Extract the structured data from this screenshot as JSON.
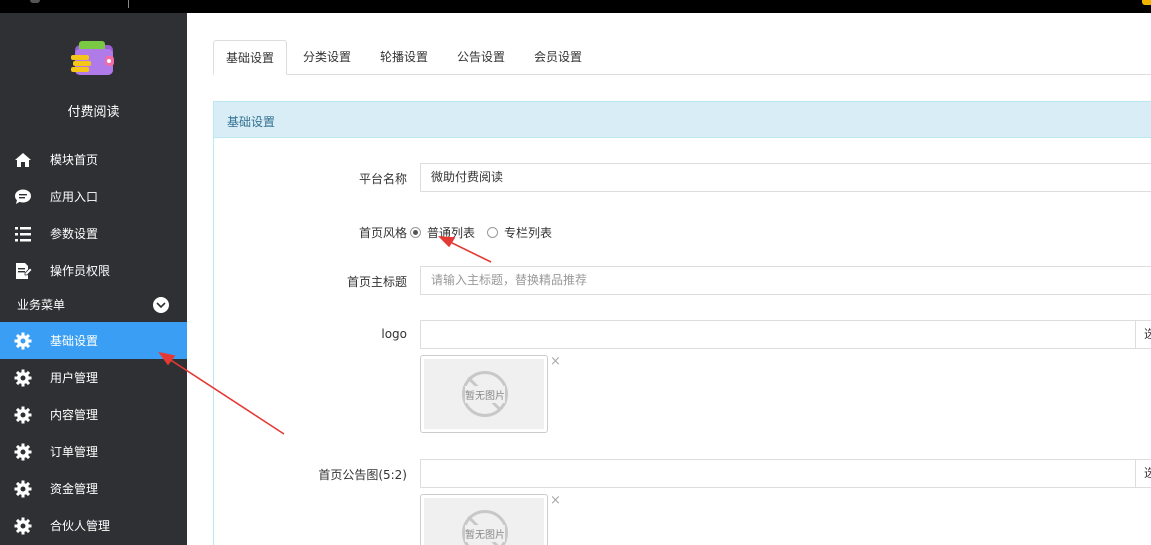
{
  "sidebar": {
    "app_name": "付费阅读",
    "items": [
      {
        "label": "模块首页",
        "icon": "home-icon"
      },
      {
        "label": "应用入口",
        "icon": "chat-icon"
      },
      {
        "label": "参数设置",
        "icon": "list-icon"
      },
      {
        "label": "操作员权限",
        "icon": "doc-edit-icon"
      }
    ],
    "group_title": "业务菜单",
    "group_items": [
      {
        "label": "基础设置",
        "icon": "gear-icon",
        "active": true
      },
      {
        "label": "用户管理",
        "icon": "gear-icon"
      },
      {
        "label": "内容管理",
        "icon": "gear-icon"
      },
      {
        "label": "订单管理",
        "icon": "gear-icon"
      },
      {
        "label": "资金管理",
        "icon": "gear-icon"
      },
      {
        "label": "合伙人管理",
        "icon": "gear-icon"
      }
    ]
  },
  "tabs": [
    "基础设置",
    "分类设置",
    "轮播设置",
    "公告设置",
    "会员设置"
  ],
  "panel": {
    "title": "基础设置",
    "platform_name_label": "平台名称",
    "platform_name_value": "微助付费阅读",
    "style_label": "首页风格",
    "style_options": [
      "普通列表",
      "专栏列表"
    ],
    "style_selected": "普通列表",
    "main_title_label": "首页主标题",
    "main_title_placeholder": "请输入主标题，替换精品推荐",
    "logo_label": "logo",
    "notice_label": "首页公告图(5:2)",
    "select_addon": "选",
    "no_image_text": "暂无图片",
    "remove_symbol": "×"
  },
  "colors": {
    "sidebar_bg": "#2f3033",
    "active_bg": "#3a9ef5",
    "panel_head_bg": "#d9edf7",
    "annotation_arrow": "#e53935"
  }
}
